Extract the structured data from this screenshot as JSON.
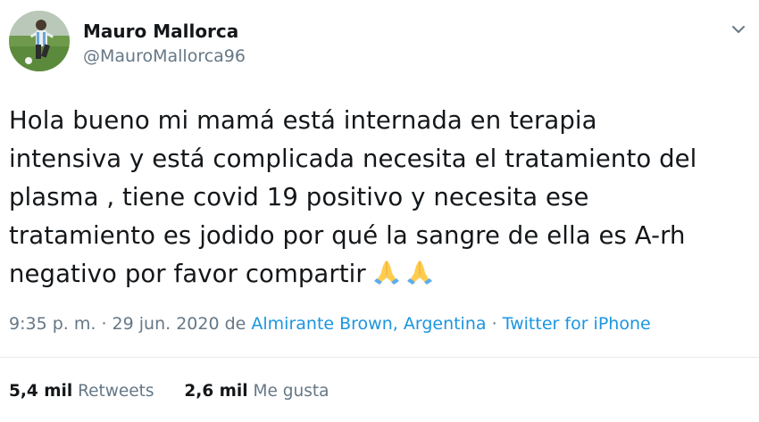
{
  "user": {
    "display_name": "Mauro Mallorca",
    "handle": "@MauroMallorca96",
    "avatar_icon": "profile-photo"
  },
  "tweet": {
    "lines": [
      "Hola bueno mi mamá está internada en terapia",
      "intensiva y está complicada necesita el tratamiento del",
      "plasma , tiene covid 19 positivo y necesita ese",
      "tratamiento es jodido por qué la sangre de ella es A-rh",
      "negativo por favor compartir"
    ],
    "emoji": [
      "🙏",
      "🙏"
    ]
  },
  "meta": {
    "time": "9:35 p. m.",
    "sep1": " · ",
    "date": "29 jun. 2020",
    "from_label": " de ",
    "location": "Almirante Brown, Argentina",
    "sep2": " · ",
    "source": "Twitter for iPhone"
  },
  "stats": {
    "retweets_count": "5,4 mil",
    "retweets_label": "Retweets",
    "likes_count": "2,6 mil",
    "likes_label": "Me gusta"
  },
  "colors": {
    "text": "#14171a",
    "secondary": "#657786",
    "link": "#1b95e0",
    "divider": "#e6ecf0"
  },
  "icons": {
    "more": "chevron-down-icon"
  }
}
